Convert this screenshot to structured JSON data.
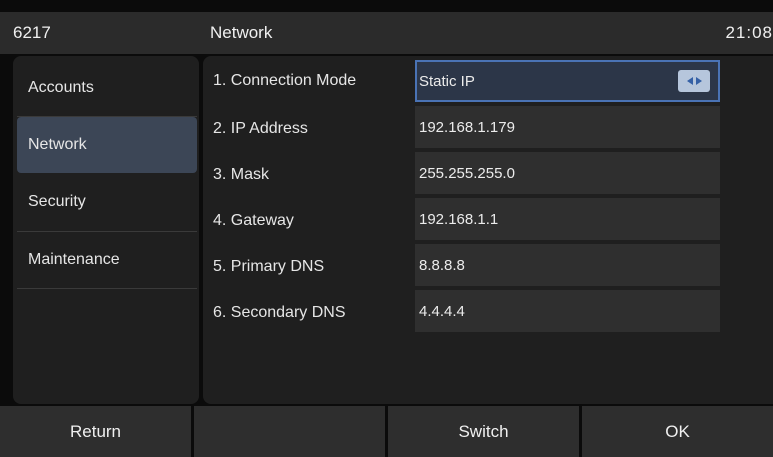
{
  "status_bar": {
    "model": "6217",
    "title": "Network",
    "clock": "21:08"
  },
  "sidebar": {
    "items": [
      {
        "label": "Accounts"
      },
      {
        "label": "Network"
      },
      {
        "label": "Security"
      },
      {
        "label": "Maintenance"
      }
    ]
  },
  "network": {
    "rows": [
      {
        "label": "1. Connection Mode",
        "value": "Static IP"
      },
      {
        "label": "2. IP Address",
        "value": "192.168.1.179"
      },
      {
        "label": "3. Mask",
        "value": "255.255.255.0"
      },
      {
        "label": "4. Gateway",
        "value": "192.168.1.1"
      },
      {
        "label": "5. Primary DNS",
        "value": "8.8.8.8"
      },
      {
        "label": "6. Secondary DNS",
        "value": "4.4.4.4"
      }
    ]
  },
  "softkeys": [
    {
      "label": "Return"
    },
    {
      "label": ""
    },
    {
      "label": "Switch"
    },
    {
      "label": "OK"
    }
  ],
  "colors": {
    "accent": "#4a73b5",
    "selected_item_bg": "#3c4656",
    "panel_bg": "#1f1f1f"
  },
  "icons": {
    "mode_spinner": "left-right-arrows-icon"
  }
}
